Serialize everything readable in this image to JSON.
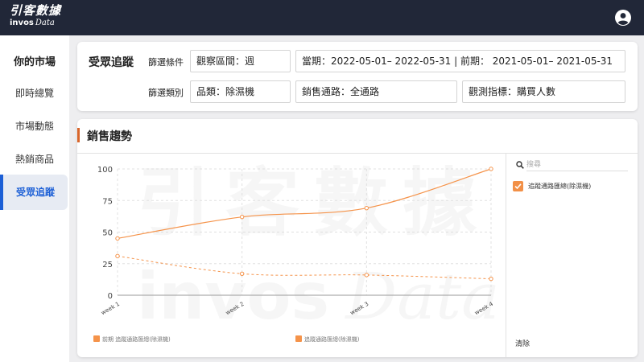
{
  "brand": {
    "name_cn": "引客數據",
    "name_en_bold": "invos",
    "name_en_italic": "Data"
  },
  "topbar": {
    "user_icon": "user-circle-icon"
  },
  "sidebar": {
    "title": "你的市場",
    "items": [
      {
        "label": "即時總覽",
        "active": false
      },
      {
        "label": "市場動態",
        "active": false
      },
      {
        "label": "熱銷商品",
        "active": false
      },
      {
        "label": "受眾追蹤",
        "active": true
      }
    ]
  },
  "filters": {
    "title": "受眾追蹤",
    "condition_label": "篩選條件",
    "category_label": "篩選類別",
    "period": "觀察區間：週",
    "date_range": "當期：2022-05-01– 2022-05-31 | 前期： 2021-05-01– 2021-05-31",
    "product": "品類：除濕機",
    "channel": "銷售通路：全通路",
    "metric": "觀測指標：購買人數"
  },
  "trend": {
    "title": "銷售趨勢",
    "search_placeholder": "搜尋",
    "legend_option": "追蹤通路匯總(除濕機)",
    "clear_label": "清除"
  },
  "colors": {
    "accent": "#f5934a",
    "title_bar": "#d9662b",
    "active_nav": "#1c5fd6",
    "topbar": "#212738"
  },
  "chart_data": {
    "type": "line",
    "x": [
      "week 1",
      "week 2",
      "week 3",
      "week 4"
    ],
    "ylim": [
      0,
      100
    ],
    "yticks": [
      0,
      25,
      50,
      75,
      100
    ],
    "grid": true,
    "legend_position": "bottom",
    "series": [
      {
        "name": "前期 追蹤通路匯總(除濕機)",
        "values": [
          31,
          17,
          16,
          13
        ],
        "style": "dashed"
      },
      {
        "name": "追蹤通路匯總(除濕機)",
        "values": [
          45,
          62,
          69,
          100
        ],
        "style": "solid"
      }
    ]
  }
}
